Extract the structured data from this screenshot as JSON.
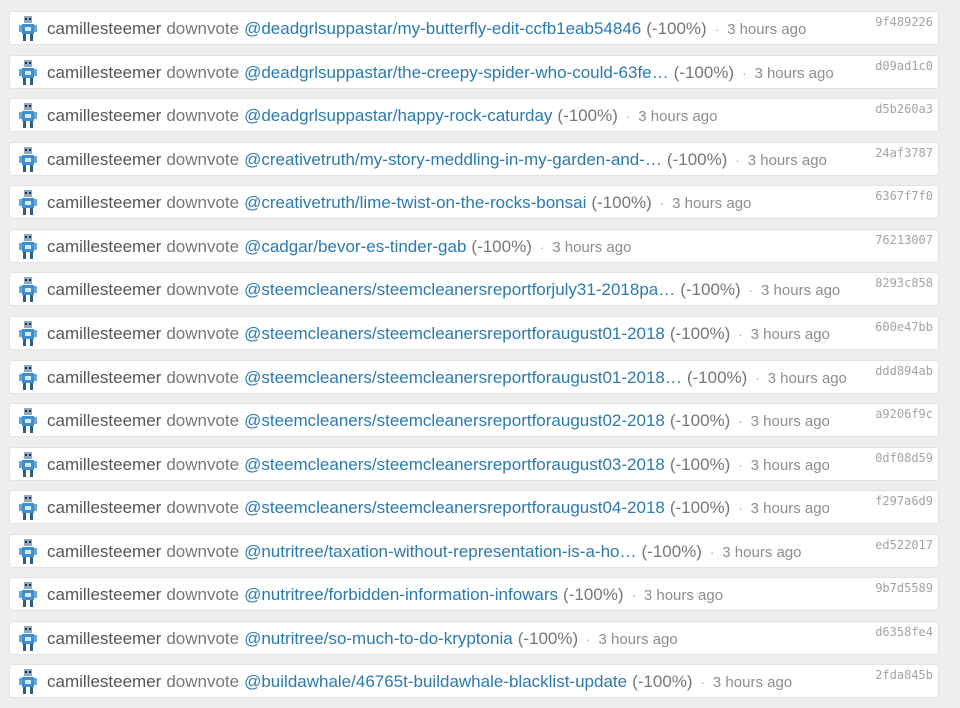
{
  "avatar_icon": "robot-avatar-icon",
  "colors": {
    "link": "#2a7ab0",
    "text": "#555555",
    "muted": "#8d8d8d",
    "row_bg": "#ffffff",
    "page_bg": "#eeeeee"
  },
  "separator": "·",
  "rows": [
    {
      "user": "camillesteemer",
      "action": "downvote",
      "post": "@deadgrlsuppastar/my-butterfly-edit-ccfb1eab54846",
      "weight": "(-100%)",
      "time": "3 hours ago",
      "hash": "9f489226"
    },
    {
      "user": "camillesteemer",
      "action": "downvote",
      "post": "@deadgrlsuppastar/the-creepy-spider-who-could-63fe…",
      "weight": "(-100%)",
      "time": "3 hours ago",
      "hash": "d09ad1c0"
    },
    {
      "user": "camillesteemer",
      "action": "downvote",
      "post": "@deadgrlsuppastar/happy-rock-caturday",
      "weight": "(-100%)",
      "time": "3 hours ago",
      "hash": "d5b260a3"
    },
    {
      "user": "camillesteemer",
      "action": "downvote",
      "post": "@creativetruth/my-story-meddling-in-my-garden-and-…",
      "weight": "(-100%)",
      "time": "3 hours ago",
      "hash": "24af3787"
    },
    {
      "user": "camillesteemer",
      "action": "downvote",
      "post": "@creativetruth/lime-twist-on-the-rocks-bonsai",
      "weight": "(-100%)",
      "time": "3 hours ago",
      "hash": "6367f7f0"
    },
    {
      "user": "camillesteemer",
      "action": "downvote",
      "post": "@cadgar/bevor-es-tinder-gab",
      "weight": "(-100%)",
      "time": "3 hours ago",
      "hash": "76213007"
    },
    {
      "user": "camillesteemer",
      "action": "downvote",
      "post": "@steemcleaners/steemcleanersreportforjuly31-2018pa…",
      "weight": "(-100%)",
      "time": "3 hours ago",
      "hash": "8293c858"
    },
    {
      "user": "camillesteemer",
      "action": "downvote",
      "post": "@steemcleaners/steemcleanersreportforaugust01-2018",
      "weight": "(-100%)",
      "time": "3 hours ago",
      "hash": "600e47bb"
    },
    {
      "user": "camillesteemer",
      "action": "downvote",
      "post": "@steemcleaners/steemcleanersreportforaugust01-2018…",
      "weight": "(-100%)",
      "time": "3 hours ago",
      "hash": "ddd894ab"
    },
    {
      "user": "camillesteemer",
      "action": "downvote",
      "post": "@steemcleaners/steemcleanersreportforaugust02-2018",
      "weight": "(-100%)",
      "time": "3 hours ago",
      "hash": "a9206f9c"
    },
    {
      "user": "camillesteemer",
      "action": "downvote",
      "post": "@steemcleaners/steemcleanersreportforaugust03-2018",
      "weight": "(-100%)",
      "time": "3 hours ago",
      "hash": "0df08d59"
    },
    {
      "user": "camillesteemer",
      "action": "downvote",
      "post": "@steemcleaners/steemcleanersreportforaugust04-2018",
      "weight": "(-100%)",
      "time": "3 hours ago",
      "hash": "f297a6d9"
    },
    {
      "user": "camillesteemer",
      "action": "downvote",
      "post": "@nutritree/taxation-without-representation-is-a-ho…",
      "weight": "(-100%)",
      "time": "3 hours ago",
      "hash": "ed522017"
    },
    {
      "user": "camillesteemer",
      "action": "downvote",
      "post": "@nutritree/forbidden-information-infowars",
      "weight": "(-100%)",
      "time": "3 hours ago",
      "hash": "9b7d5589"
    },
    {
      "user": "camillesteemer",
      "action": "downvote",
      "post": "@nutritree/so-much-to-do-kryptonia",
      "weight": "(-100%)",
      "time": "3 hours ago",
      "hash": "d6358fe4"
    },
    {
      "user": "camillesteemer",
      "action": "downvote",
      "post": "@buildawhale/46765t-buildawhale-blacklist-update",
      "weight": "(-100%)",
      "time": "3 hours ago",
      "hash": "2fda845b"
    }
  ]
}
